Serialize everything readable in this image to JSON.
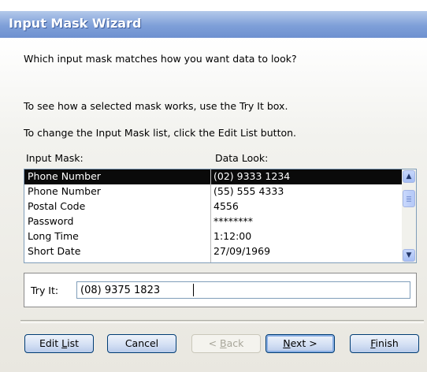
{
  "window": {
    "title": "Input Mask Wizard"
  },
  "prompt": "Which input mask matches how you want data to look?",
  "info": {
    "try_hint": "To see how a selected mask works, use the Try It box.",
    "edit_hint": "To change the Input Mask list, click the Edit List button."
  },
  "list": {
    "col_mask": "Input Mask:",
    "col_look": "Data Look:",
    "rows": [
      {
        "mask": "Phone Number",
        "look": "(02) 9333 1234",
        "selected": true
      },
      {
        "mask": "Phone Number",
        "look": "(55) 555 4333"
      },
      {
        "mask": "Postal Code",
        "look": "4556"
      },
      {
        "mask": "Password",
        "look": "********"
      },
      {
        "mask": "Long Time",
        "look": "1:12:00"
      },
      {
        "mask": "Short Date",
        "look": "27/09/1969"
      }
    ]
  },
  "try_it": {
    "label": "Try It:",
    "value": "(08) 9375 1823"
  },
  "buttons": {
    "edit_list": {
      "pre": "Edit ",
      "key": "L",
      "post": "ist"
    },
    "cancel": {
      "label": "Cancel"
    },
    "back": {
      "pre": "< ",
      "key": "B",
      "post": "ack",
      "disabled": true
    },
    "next": {
      "pre": "",
      "key": "N",
      "post": "ext >"
    },
    "finish": {
      "pre": "",
      "key": "F",
      "post": "inish"
    }
  },
  "icons": {
    "scroll_up": "chevron-up-icon",
    "scroll_down": "chevron-down-icon"
  },
  "colors": {
    "title_bar": "#7e9fd8",
    "selection": "#0a0a0a",
    "button_border": "#003c74"
  }
}
